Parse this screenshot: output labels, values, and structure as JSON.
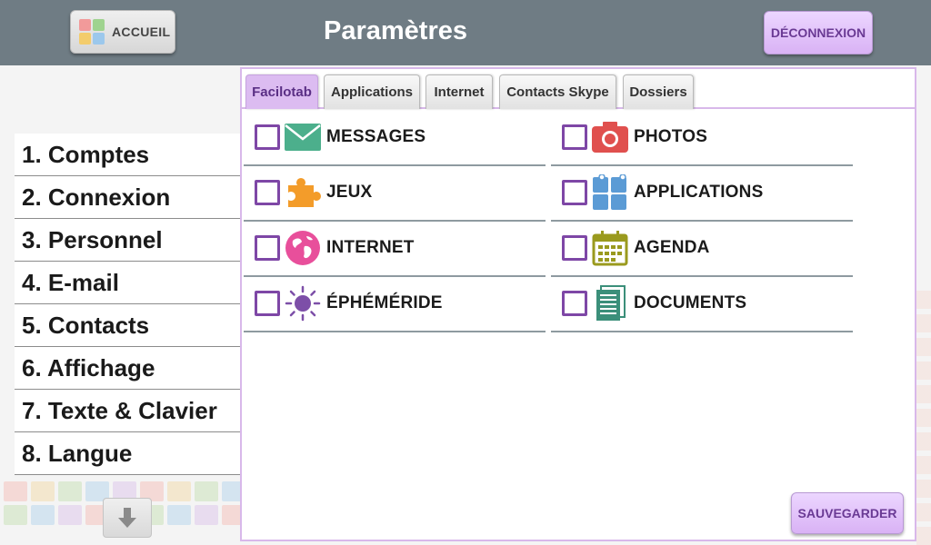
{
  "header": {
    "home_label": "ACCUEIL",
    "title": "Paramètres",
    "logout_label": "DÉCONNEXION"
  },
  "sidebar": {
    "items": [
      {
        "label": "1. Comptes"
      },
      {
        "label": "2. Connexion"
      },
      {
        "label": "3. Personnel"
      },
      {
        "label": "4. E-mail"
      },
      {
        "label": "5. Contacts"
      },
      {
        "label": "6. Affichage"
      },
      {
        "label": "7. Texte & Clavier"
      },
      {
        "label": "8. Langue"
      }
    ],
    "scroll_icon": "arrow-down-icon"
  },
  "tabs": [
    {
      "label": "Facilotab",
      "active": true
    },
    {
      "label": "Applications",
      "active": false
    },
    {
      "label": "Internet",
      "active": false
    },
    {
      "label": "Contacts Skype",
      "active": false
    },
    {
      "label": "Dossiers",
      "active": false
    }
  ],
  "options": [
    {
      "label": "MESSAGES",
      "icon": "envelope-icon",
      "checked": false
    },
    {
      "label": "PHOTOS",
      "icon": "camera-icon",
      "checked": false
    },
    {
      "label": "JEUX",
      "icon": "puzzle-icon",
      "checked": false
    },
    {
      "label": "APPLICATIONS",
      "icon": "app-grid-icon",
      "checked": false
    },
    {
      "label": "INTERNET",
      "icon": "globe-icon",
      "checked": false
    },
    {
      "label": "AGENDA",
      "icon": "calendar-icon",
      "checked": false
    },
    {
      "label": "ÉPHÉMÉRIDE",
      "icon": "sun-icon",
      "checked": false
    },
    {
      "label": "DOCUMENTS",
      "icon": "document-icon",
      "checked": false
    }
  ],
  "save_label": "SAUVEGARDER",
  "colors": {
    "header": "#6f7c84",
    "accent_purple": "#7e47a6",
    "button_purple": "#dcbcf1",
    "envelope": "#4caf8c",
    "camera": "#e0504e",
    "puzzle": "#f39c2a",
    "apps": "#5b9bd5",
    "globe": "#e84f9b",
    "calendar": "#9a9a1e",
    "sun": "#7d4fa8",
    "document": "#3b8f7a"
  }
}
